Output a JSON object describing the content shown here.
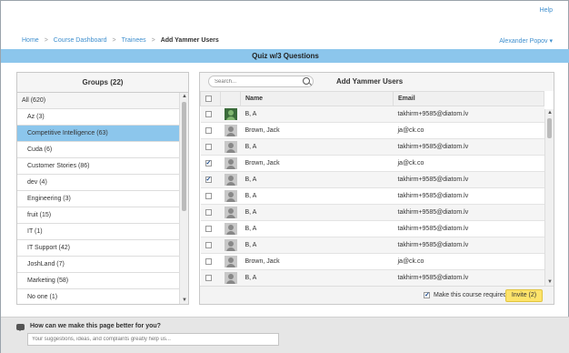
{
  "header": {
    "help": "Help",
    "breadcrumbs": [
      "Home",
      "Course Dashboard",
      "Trainees",
      "Add Yammer Users"
    ],
    "separator": ">",
    "user": "Alexander Popov"
  },
  "quiz_title": "Quiz w/3 Questions",
  "groups": {
    "title": "Groups (22)",
    "items": [
      "All (620)",
      "Az (3)",
      "Competitive Intelligence (63)",
      "Cuda (6)",
      "Customer Stories (86)",
      "dev (4)",
      "Engineering (3)",
      "fruit (15)",
      "IT (1)",
      "IT Support (42)",
      "JoshLand (7)",
      "Marketing (58)",
      "No one (1)"
    ],
    "selected_index": 2
  },
  "yammer": {
    "title": "Add Yammer Users",
    "search_placeholder": "Search...",
    "columns": [
      "Name",
      "Email"
    ],
    "rows": [
      {
        "name": "B, A",
        "email": "takhirm+9585@diatom.lv",
        "checked": false,
        "photo": true
      },
      {
        "name": "Brown, Jack",
        "email": "ja@ck.co",
        "checked": false,
        "photo": false
      },
      {
        "name": "B, A",
        "email": "takhirm+9585@diatom.lv",
        "checked": false,
        "photo": false
      },
      {
        "name": "Brown, Jack",
        "email": "ja@ck.co",
        "checked": true,
        "photo": false
      },
      {
        "name": "B, A",
        "email": "takhirm+9585@diatom.lv",
        "checked": true,
        "photo": false
      },
      {
        "name": "B, A",
        "email": "takhirm+9585@diatom.lv",
        "checked": false,
        "photo": false
      },
      {
        "name": "B, A",
        "email": "takhirm+9585@diatom.lv",
        "checked": false,
        "photo": false
      },
      {
        "name": "B, A",
        "email": "takhirm+9585@diatom.lv",
        "checked": false,
        "photo": false
      },
      {
        "name": "B, A",
        "email": "takhirm+9585@diatom.lv",
        "checked": false,
        "photo": false
      },
      {
        "name": "Brown, Jack",
        "email": "ja@ck.co",
        "checked": false,
        "photo": false
      },
      {
        "name": "B, A",
        "email": "takhirm+9585@diatom.lv",
        "checked": false,
        "photo": false
      }
    ],
    "make_required_label": "Make this course required",
    "make_required_checked": true,
    "invite_label": "Invite (2)"
  },
  "feedback": {
    "question": "How can we make this page better for you?",
    "placeholder": "Your suggestions, ideas, and complaints greatly help us..."
  }
}
